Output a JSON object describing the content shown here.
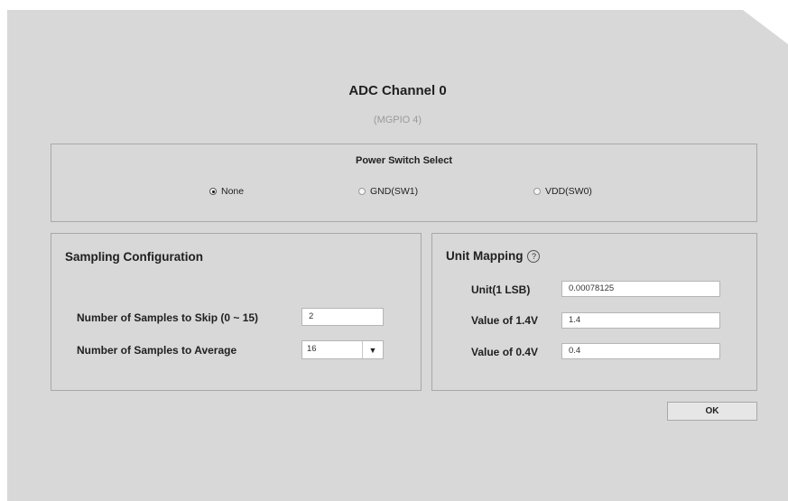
{
  "dialog": {
    "title": "ADC Channel 0",
    "subtitle": "(MGPIO 4)"
  },
  "power_switch": {
    "title": "Power Switch Select",
    "options": [
      {
        "label": "None",
        "selected": true
      },
      {
        "label": "GND(SW1)",
        "selected": false
      },
      {
        "label": "VDD(SW0)",
        "selected": false
      }
    ]
  },
  "sampling": {
    "title": "Sampling Configuration",
    "skip_label": "Number of Samples to Skip (0 ~ 15)",
    "skip_value": "2",
    "average_label": "Number of Samples to Average",
    "average_value": "16"
  },
  "unit_mapping": {
    "title": "Unit Mapping",
    "help_icon": "question-circle-icon",
    "unit_label": "Unit(1 LSB)",
    "unit_value": "0.00078125",
    "v14_label": "Value of 1.4V",
    "v14_value": "1.4",
    "v04_label": "Value of 0.4V",
    "v04_value": "0.4"
  },
  "actions": {
    "ok_label": "OK"
  }
}
